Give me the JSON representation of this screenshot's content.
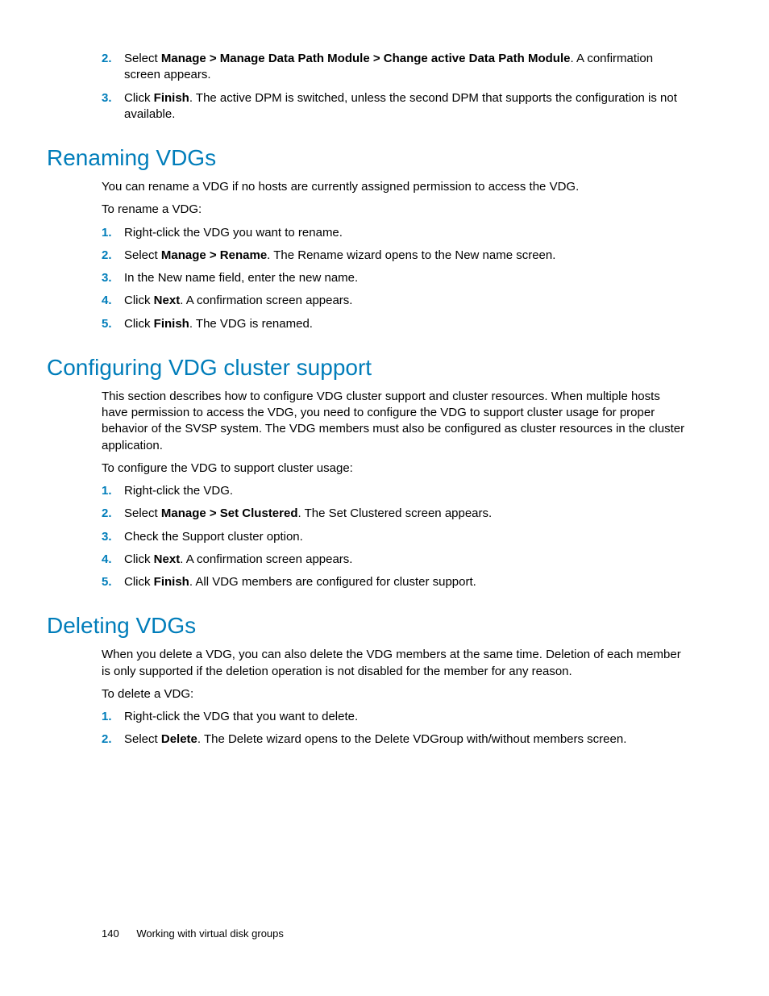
{
  "intro_steps": [
    {
      "num": "2.",
      "html": "Select <b>Manage > Manage Data Path Module > Change active Data Path Module</b>. A confirmation screen appears."
    },
    {
      "num": "3.",
      "html": "Click <b>Finish</b>. The active DPM is switched, unless the second DPM that supports the configuration is not available."
    }
  ],
  "sections": {
    "renaming": {
      "title": "Renaming VDGs",
      "intro": "You can rename a VDG if no hosts are currently assigned permission to access the VDG.",
      "lead": "To rename a VDG:",
      "steps": [
        {
          "num": "1.",
          "html": "Right-click the VDG you want to rename."
        },
        {
          "num": "2.",
          "html": "Select <b>Manage > Rename</b>. The Rename wizard opens to the New name screen."
        },
        {
          "num": "3.",
          "html": "In the New name field, enter the new name."
        },
        {
          "num": "4.",
          "html": "Click <b>Next</b>. A confirmation screen appears."
        },
        {
          "num": "5.",
          "html": "Click <b>Finish</b>. The VDG is renamed."
        }
      ]
    },
    "configuring": {
      "title": "Configuring VDG cluster support",
      "intro": "This section describes how to configure VDG cluster support and cluster resources. When multiple hosts have permission to access the VDG, you need to configure the VDG to support cluster usage for proper behavior of the SVSP system. The VDG members must also be configured as cluster resources in the cluster application.",
      "lead": "To configure the VDG to support cluster usage:",
      "steps": [
        {
          "num": "1.",
          "html": "Right-click the VDG."
        },
        {
          "num": "2.",
          "html": "Select <b>Manage > Set Clustered</b>. The Set Clustered screen appears."
        },
        {
          "num": "3.",
          "html": "Check the Support cluster option."
        },
        {
          "num": "4.",
          "html": "Click <b>Next</b>. A confirmation screen appears."
        },
        {
          "num": "5.",
          "html": "Click <b>Finish</b>. All VDG members are configured for cluster support."
        }
      ]
    },
    "deleting": {
      "title": "Deleting VDGs",
      "intro": "When you delete a VDG, you can also delete the VDG members at the same time. Deletion of each member is only supported if the deletion operation is not disabled for the member for any reason.",
      "lead": "To delete a VDG:",
      "steps": [
        {
          "num": "1.",
          "html": "Right-click the VDG that you want to delete."
        },
        {
          "num": "2.",
          "html": "Select <b>Delete</b>. The Delete wizard opens to the Delete VDGroup with/without members screen."
        }
      ]
    }
  },
  "footer": {
    "page": "140",
    "chapter": "Working with virtual disk groups"
  }
}
